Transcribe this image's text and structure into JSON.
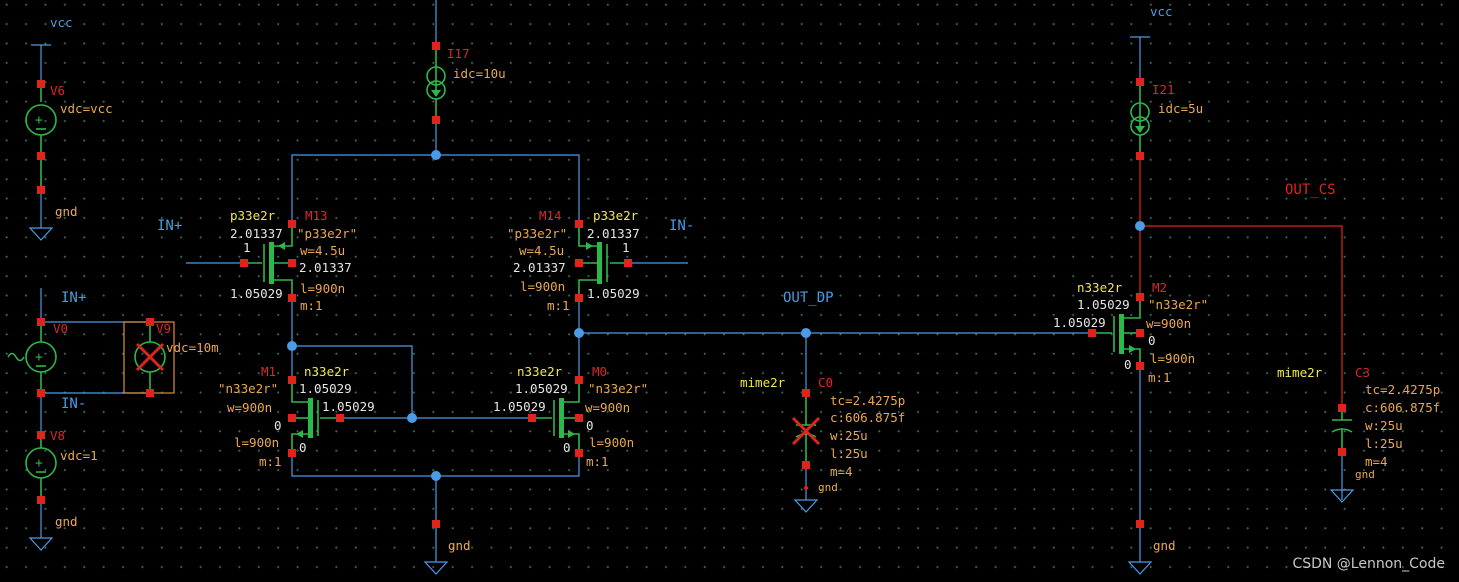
{
  "labels": {
    "vcc_left": "vcc",
    "vcc_right": "vcc",
    "gnd": "gnd",
    "in_plus_mos": "IN+",
    "in_minus_mos": "IN-",
    "in_plus_src": "IN+",
    "in_minus_src": "IN-",
    "out_dp": "OUT_DP",
    "out_cs": "OUT_CS",
    "watermark": "CSDN @Lennon_Code"
  },
  "sources": {
    "v6": {
      "name": "V6",
      "param": "vdc=vcc"
    },
    "v0": {
      "name": "V0"
    },
    "v9": {
      "name": "V9",
      "param": "vdc=10m"
    },
    "v8": {
      "name": "V8",
      "param": "vdc=1"
    },
    "i17": {
      "name": "I17",
      "param": "idc=10u"
    },
    "i21": {
      "name": "I21",
      "param": "idc=5u"
    }
  },
  "transistors": {
    "m13": {
      "name": "M13",
      "cell": "p33e2r",
      "quoted": "\"p33e2r\"",
      "w": "w=4.5u",
      "l": "l=900n",
      "m": "m:1",
      "v1": "2.01337",
      "v2": "2.01337",
      "v3": "1.05029",
      "gate": "1"
    },
    "m14": {
      "name": "M14",
      "cell": "p33e2r",
      "quoted": "\"p33e2r\"",
      "w": "w=4.5u",
      "l": "l=900n",
      "m": "m:1",
      "v1": "2.01337",
      "v2": "2.01337",
      "v3": "1.05029",
      "gate": "1"
    },
    "m1": {
      "name": "M1",
      "cell": "n33e2r",
      "quoted": "\"n33e2r\"",
      "w": "w=900n",
      "l": "l=900n",
      "m": "m:1",
      "v1": "1.05029",
      "v2": "1.05029",
      "v3": "0",
      "v4": "0"
    },
    "m0": {
      "name": "M0",
      "cell": "n33e2r",
      "quoted": "\"n33e2r\"",
      "w": "w=900n",
      "l": "l=900n",
      "m": "m:1",
      "v1": "1.05029",
      "v2": "1.05029",
      "v3": "0",
      "v4": "0"
    },
    "m2": {
      "name": "M2",
      "cell": "n33e2r",
      "quoted": "\"n33e2r\"",
      "w": "w=900n",
      "l": "l=900n",
      "m": "m:1",
      "v1": "1.05029",
      "v2": "1.05029",
      "v3": "0",
      "v4": "0"
    }
  },
  "caps": {
    "c0": {
      "name": "C0",
      "cell": "mime2r",
      "tc": "tc=2.4275p",
      "c": "c:606.875f",
      "w": "w:25u",
      "l": "l:25u",
      "m": "m=4"
    },
    "c3": {
      "name": "C3",
      "cell": "mime2r",
      "tc": "tc=2.4275p",
      "c": "c:606.875f",
      "w": "w:25u",
      "l": "l:25u",
      "m": "m=4"
    }
  },
  "colors": {
    "wire": "#4b9be6",
    "wire_selected": "#e0241c",
    "device": "#2db84a",
    "pin": "#e0241c",
    "instance_name": "#d92828",
    "param": "#e8a850",
    "cell": "#f0e84a",
    "background": "#000000"
  }
}
